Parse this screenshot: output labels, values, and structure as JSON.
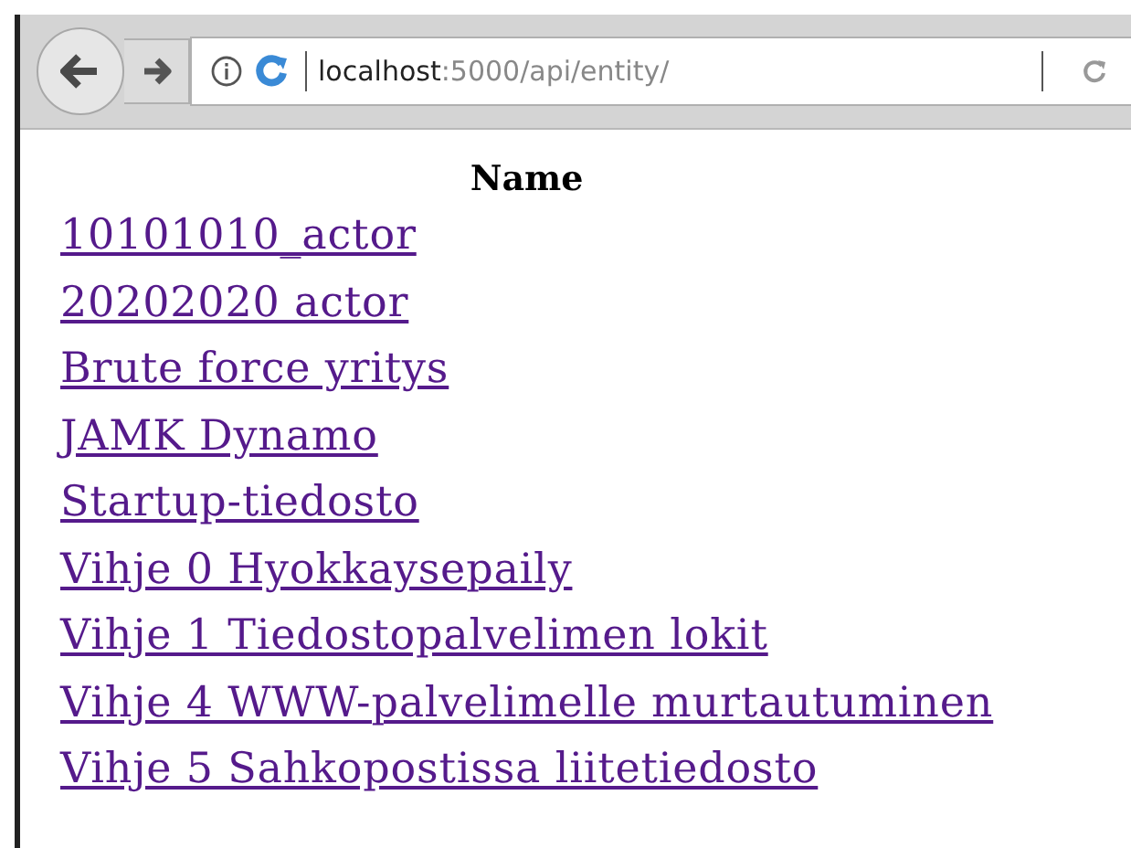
{
  "address_bar": {
    "host": "localhost",
    "path": ":5000/api/entity/"
  },
  "table": {
    "columns": [
      "Name"
    ],
    "rows": [
      "10101010_actor",
      "20202020 actor",
      "Brute force yritys",
      "JAMK Dynamo",
      "Startup-tiedosto",
      "Vihje 0 Hyokkaysepaily",
      "Vihje 1 Tiedostopalvelimen lokit",
      "Vihje 4 WWW-palvelimelle murtautuminen",
      "Vihje 5 Sahkopostissa liitetiedosto"
    ]
  }
}
